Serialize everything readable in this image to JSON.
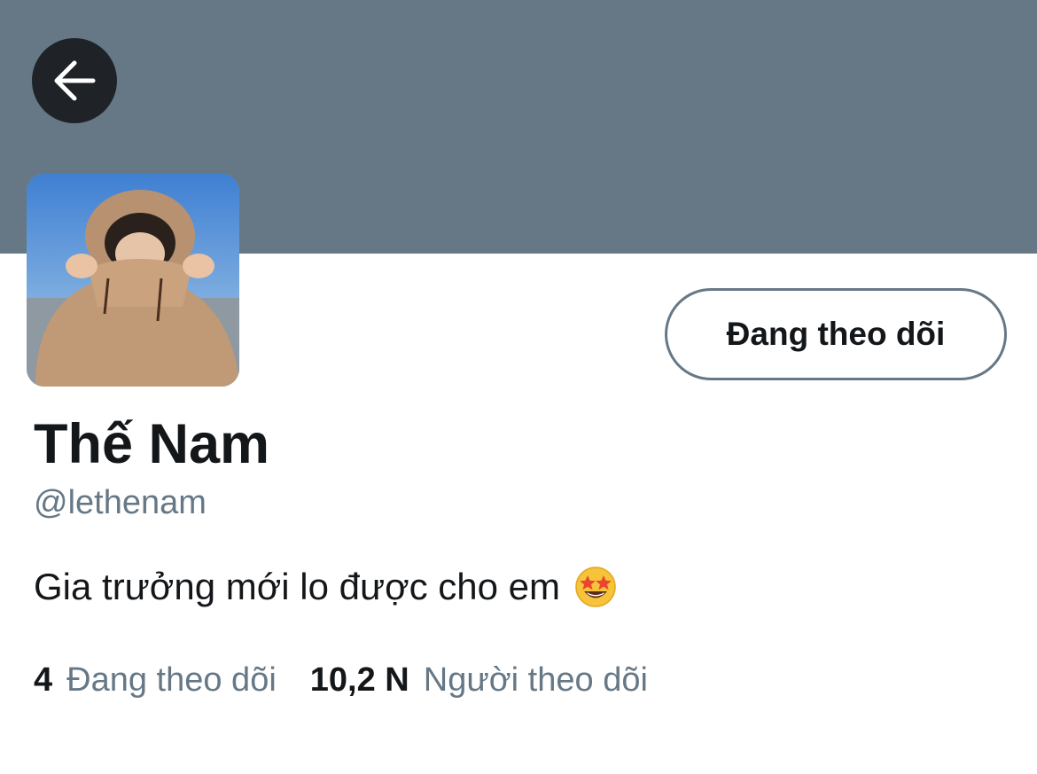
{
  "banner": {
    "color": "#667886"
  },
  "nav": {
    "back_icon": "arrow-left-icon"
  },
  "profile": {
    "follow_button_label": "Đang theo dõi",
    "display_name": "Thế Nam",
    "handle": "@lethenam",
    "bio": "Gia trưởng mới lo được cho em",
    "bio_emoji": "star-struck-emoji"
  },
  "stats": {
    "following_count": "4",
    "following_label": "Đang theo dõi",
    "followers_count": "10,2 N",
    "followers_label": "Người theo dõi"
  },
  "colors": {
    "text_primary": "#14171a",
    "text_secondary": "#667886",
    "back_button_bg": "#1f2327"
  }
}
